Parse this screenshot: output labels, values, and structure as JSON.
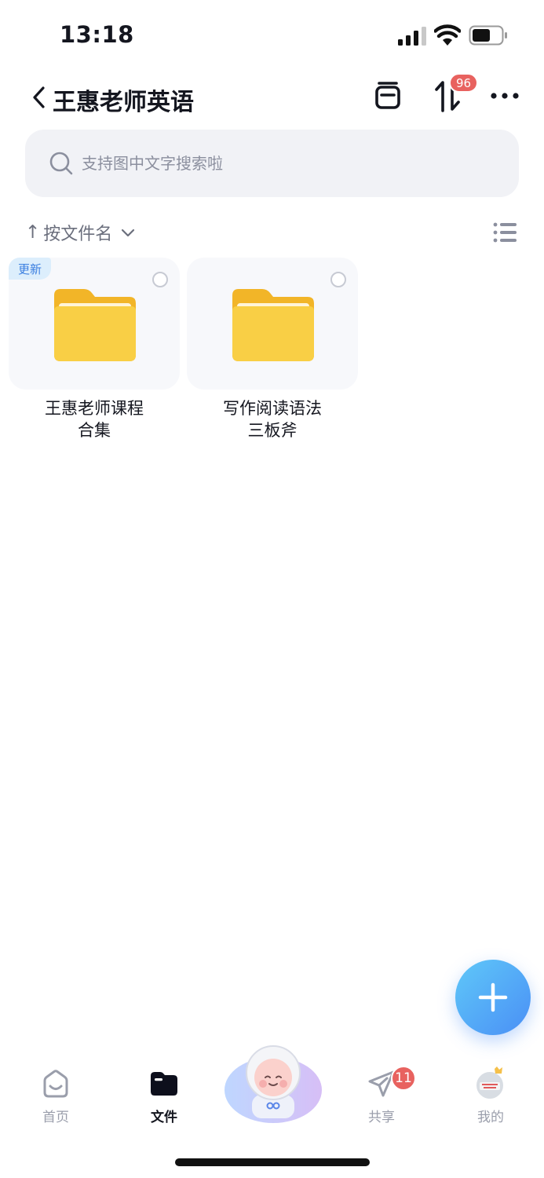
{
  "status_bar": {
    "time": "13:18"
  },
  "header": {
    "title": "王惠老师英语",
    "transfer_badge": "96"
  },
  "search": {
    "placeholder": "支持图中文字搜索啦"
  },
  "sort": {
    "label": "按文件名"
  },
  "folders": [
    {
      "tag": "更新",
      "name_line1": "王惠老师课程",
      "name_line2": "合集"
    },
    {
      "name_line1": "写作阅读语法",
      "name_line2": "三板斧"
    }
  ],
  "nav": {
    "items": [
      {
        "label": "首页"
      },
      {
        "label": "文件"
      },
      {
        "label": "共享",
        "badge": "11"
      },
      {
        "label": "我的"
      }
    ],
    "active": "文件"
  },
  "colors": {
    "accent_blue": "#4a8ff6",
    "badge_red": "#e8625f",
    "folder_yellow": "#f9cf45",
    "tag_bg": "#dceefc"
  },
  "icons": [
    "back-icon",
    "archive-icon",
    "transfer-icon",
    "more-icon",
    "search-icon",
    "chevron-down-icon",
    "list-view-icon",
    "folder-icon",
    "plus-icon",
    "home-icon",
    "files-icon",
    "share-icon",
    "avatar"
  ]
}
